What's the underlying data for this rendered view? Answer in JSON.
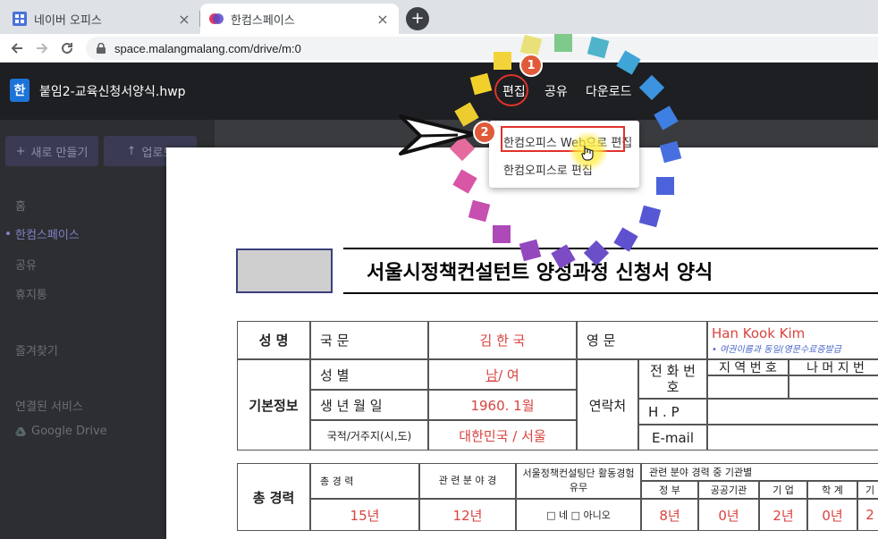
{
  "browser": {
    "tabs": [
      {
        "title": "네이버 오피스",
        "close": "×"
      },
      {
        "title": "한컴스페이스",
        "close": "×"
      }
    ],
    "new_tab": "+",
    "url": "space.malangmalang.com/drive/m:0"
  },
  "app": {
    "logo_letter": "한",
    "doc_name": "붙임2-교육신청서양식.hwp",
    "menu": {
      "edit": "편집",
      "share": "공유",
      "download": "다운로드",
      "more": "⋮"
    }
  },
  "sidebar": {
    "new_button": "새로 만들기",
    "upload_button": "업로드",
    "items": [
      "홈",
      "한컴스페이스",
      "공유",
      "휴지통",
      "즐겨찾기",
      "연결된 서비스",
      "Google Drive"
    ]
  },
  "dropdown": {
    "items": [
      "한컴오피스 Web으로 편집",
      "한컴오피스로 편집"
    ]
  },
  "annotations": {
    "step1": "1",
    "step2": "2"
  },
  "document": {
    "title": "서울시정책컨설턴트 양성과정 신청서 양식",
    "name_label": "성 명",
    "korean_label": "국 문",
    "korean_name": "김 한 국",
    "english_label": "영 문",
    "english_name": "Han Kook Kim",
    "english_note": "• 여권이름과 동일(영문수료증발급",
    "basic_label": "기본정보",
    "gender_label": "성 별",
    "gender_male": "남",
    "gender_rest": " / 여",
    "birth_label": "생 년 월 일",
    "birth_value": "1960. 1월",
    "nation_label": "국적/거주지(시,도)",
    "nation_value": "대한민국 / 서울",
    "contact_label": "연락처",
    "phone_label": "전 화 번 호",
    "area_code": "지 역 번 호",
    "rest_number": "나 머 지 번",
    "hp_label": "H . P",
    "email_label": "E-mail",
    "career_label": "총 경력",
    "total_career_label": "총 경 력",
    "related_career_label": "관 련 분 야 경",
    "related_career_label2": "관 련 분 야 경 력",
    "consulting_label": "서울정책컨설팅단 활동경험유무",
    "consulting_value": "□ 네 □ 아니오",
    "org_career_label": "관련 분야 경력 중 기관별",
    "gov_label": "정 부",
    "public_label": "공공기관",
    "company_label": "기 업",
    "academic_label": "학 계",
    "other_label": "기",
    "total_career_value": "15년",
    "related_value": "12년",
    "gov_value": "8년",
    "public_value": "0년",
    "company_value": "2년",
    "academic_value": "0년",
    "other_value": "2"
  },
  "colors": {
    "accent": "#e0322b",
    "badge": "#e05a3a",
    "form_red": "#d8433f",
    "header_bg": "#1e1f22"
  }
}
